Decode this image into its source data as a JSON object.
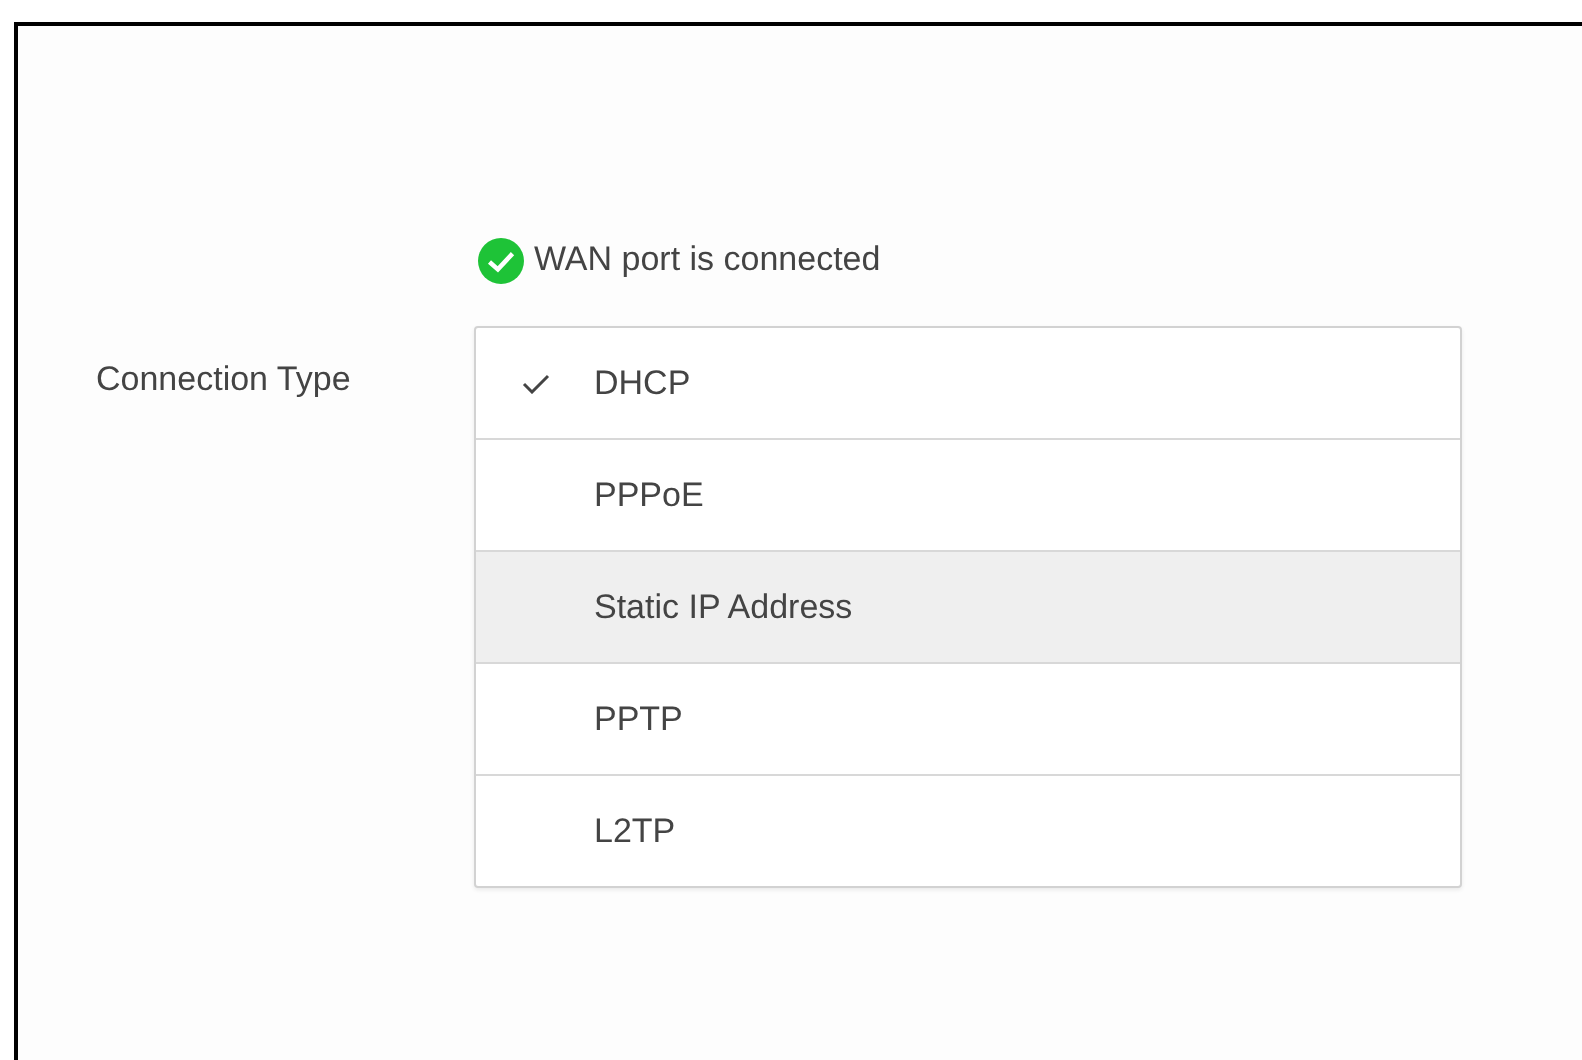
{
  "status": {
    "text": "WAN port is connected",
    "connected": true
  },
  "connection_type": {
    "label": "Connection Type",
    "options": [
      {
        "label": "DHCP",
        "selected": true,
        "highlighted": false
      },
      {
        "label": "PPPoE",
        "selected": false,
        "highlighted": false
      },
      {
        "label": "Static IP Address",
        "selected": false,
        "highlighted": true
      },
      {
        "label": "PPTP",
        "selected": false,
        "highlighted": false
      },
      {
        "label": "L2TP",
        "selected": false,
        "highlighted": false
      }
    ]
  }
}
